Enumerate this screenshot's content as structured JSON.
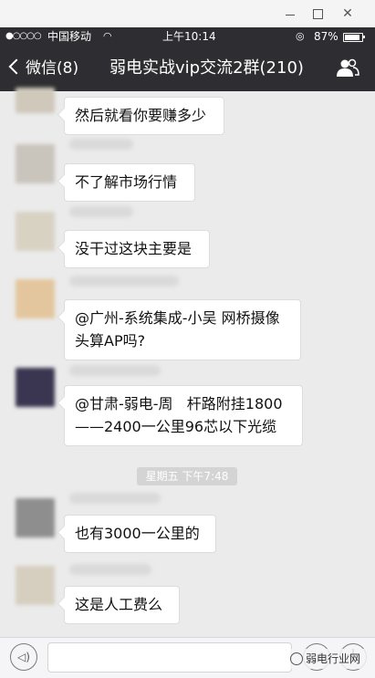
{
  "window_controls": {
    "minimize_icon": "minimize-icon",
    "maximize_icon": "maximize-icon",
    "close_symbol": "✕"
  },
  "status_bar": {
    "signal": "●○○○○",
    "carrier": "中国移动",
    "wifi_symbol": "◠",
    "time": "上午10:14",
    "lock_symbol": "◎",
    "battery_percent": "87%",
    "battery_level": 0.87
  },
  "nav": {
    "back_label": "微信(8)",
    "title": "弱电实战vip交流2群(210)",
    "people_icon": "group-members-icon"
  },
  "messages": [
    {
      "text": "然后就看你要赚多少",
      "avatar_color": "#cfc8bb"
    },
    {
      "text": "不了解市场行情",
      "avatar_color": "#c9c4bc"
    },
    {
      "text": "没干过这块主要是",
      "avatar_color": "#d8d2c3"
    },
    {
      "text": "@广州-系统集成-小吴 网桥摄像\n头算AP吗?",
      "avatar_color": "#e3c69d"
    },
    {
      "text": "@甘肃-弱电-周   杆路附挂1800\n——2400一公里96芯以下光缆",
      "avatar_color": "#3a3550"
    },
    {
      "text": "也有3000一公里的",
      "avatar_color": "#8e8e8e"
    },
    {
      "text": "这是人工费么",
      "avatar_color": "#d6cfc0"
    }
  ],
  "timestamp": "星期五 下午7:48",
  "input_bar": {
    "voice_symbol": "◁)",
    "plus_symbol": "+"
  },
  "watermark": "弱电行业网"
}
